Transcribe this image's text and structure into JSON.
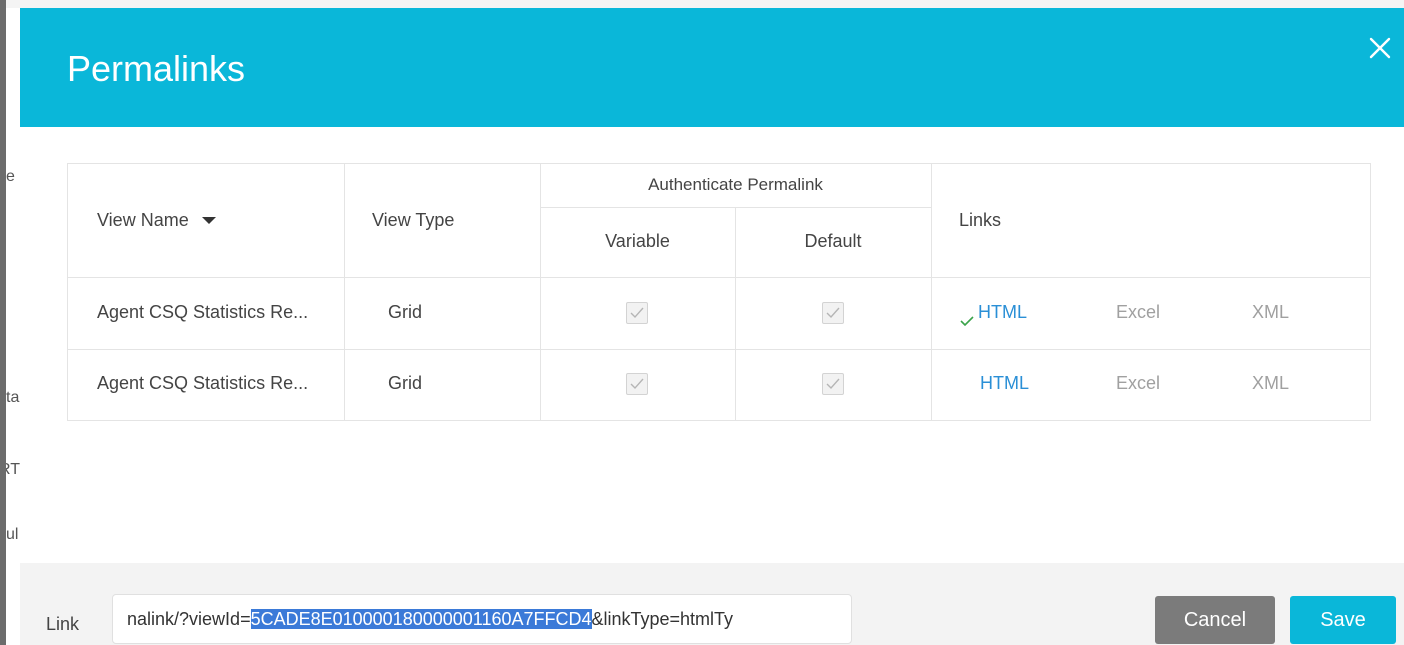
{
  "background": {
    "fragments": [
      "e",
      "ta",
      "RT",
      "ul"
    ]
  },
  "modal": {
    "title": "Permalinks",
    "close_icon": "close-icon"
  },
  "table": {
    "headers": {
      "view_name": "View Name",
      "view_type": "View Type",
      "authenticate": "Authenticate Permalink",
      "variable": "Variable",
      "default": "Default",
      "links": "Links"
    },
    "sort_icon": "sort-down-icon",
    "rows": [
      {
        "view_name": "Agent CSQ Statistics Re...",
        "view_type": "Grid",
        "variable_checked": true,
        "default_checked": true,
        "html": "HTML",
        "html_selected": true,
        "excel": "Excel",
        "xml": "XML"
      },
      {
        "view_name": "Agent CSQ Statistics Re...",
        "view_type": "Grid",
        "variable_checked": true,
        "default_checked": true,
        "html": "HTML",
        "html_selected": false,
        "excel": "Excel",
        "xml": "XML"
      }
    ]
  },
  "footer": {
    "link_label": "Link",
    "link_prefix": "nalink/?viewId=",
    "link_selected": "5CADE8E010000180000001160A7FFCD4",
    "link_suffix": "&linkType=htmlTy",
    "cancel": "Cancel",
    "save": "Save"
  },
  "colors": {
    "header_bg": "#0ab7d9",
    "link_blue": "#2a8fd6",
    "cancel_bg": "#7b7b7b",
    "selection": "#3b7ad8"
  }
}
